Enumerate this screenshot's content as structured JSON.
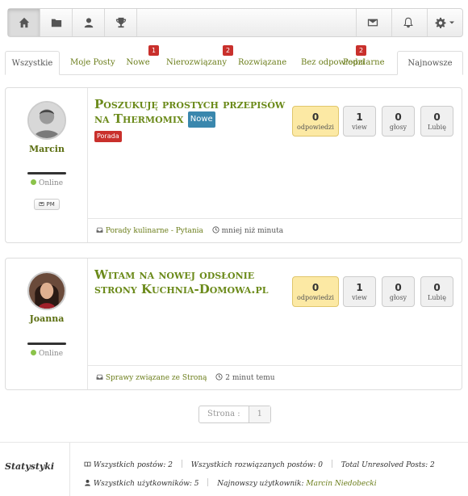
{
  "tabs": [
    {
      "label": "Wszystkie",
      "active": true
    },
    {
      "label": "Moje Posty"
    },
    {
      "label": "Nowe",
      "badge": "1"
    },
    {
      "label": "Nierozwiązany",
      "badge": "2"
    },
    {
      "label": "Rozwiązane"
    },
    {
      "label": "Bez odpowiedzi"
    },
    {
      "label": "Popularne",
      "badge": "2"
    },
    {
      "label": "Najnowsze",
      "active": true
    }
  ],
  "posts": [
    {
      "author": "Marcin",
      "online": "Online",
      "pm": "PM",
      "title": "Poszukuję prostych przepisów na Thermomix",
      "new_badge": "Nowe",
      "tag": "Porada",
      "stats": {
        "answers": "0",
        "answers_label": "odpowiedzi",
        "views": "1",
        "views_label": "view",
        "votes": "0",
        "votes_label": "głosy",
        "likes": "0",
        "likes_label": "Lubię"
      },
      "category": "Porady kulinarne - Pytania",
      "time": "mniej niż minuta"
    },
    {
      "author": "Joanna",
      "online": "Online",
      "title": "Witam na nowej odsłonie strony Kuchnia-Domowa.pl",
      "stats": {
        "answers": "0",
        "answers_label": "odpowiedzi",
        "views": "1",
        "views_label": "view",
        "votes": "0",
        "votes_label": "głosy",
        "likes": "0",
        "likes_label": "Lubię"
      },
      "category": "Sprawy związane ze Stroną",
      "time": "2 minut temu"
    }
  ],
  "pager": {
    "label": "Strona :",
    "page": "1"
  },
  "stats": {
    "title": "Statystyki",
    "total_posts": "Wszystkich postów: 2",
    "total_resolved": "Wszystkich rozwiązanych postów: 0",
    "total_unresolved": "Total Unresolved Posts: 2",
    "total_users": "Wszystkich użytkowników: 5",
    "newest_user_label": "Najnowszy użytkownik:",
    "newest_user": "Marcin Niedobecki"
  },
  "icons": [
    "home-icon",
    "folder-icon",
    "user-icon",
    "trophy-icon",
    "envelope-icon",
    "bell-icon",
    "gear-icon"
  ]
}
